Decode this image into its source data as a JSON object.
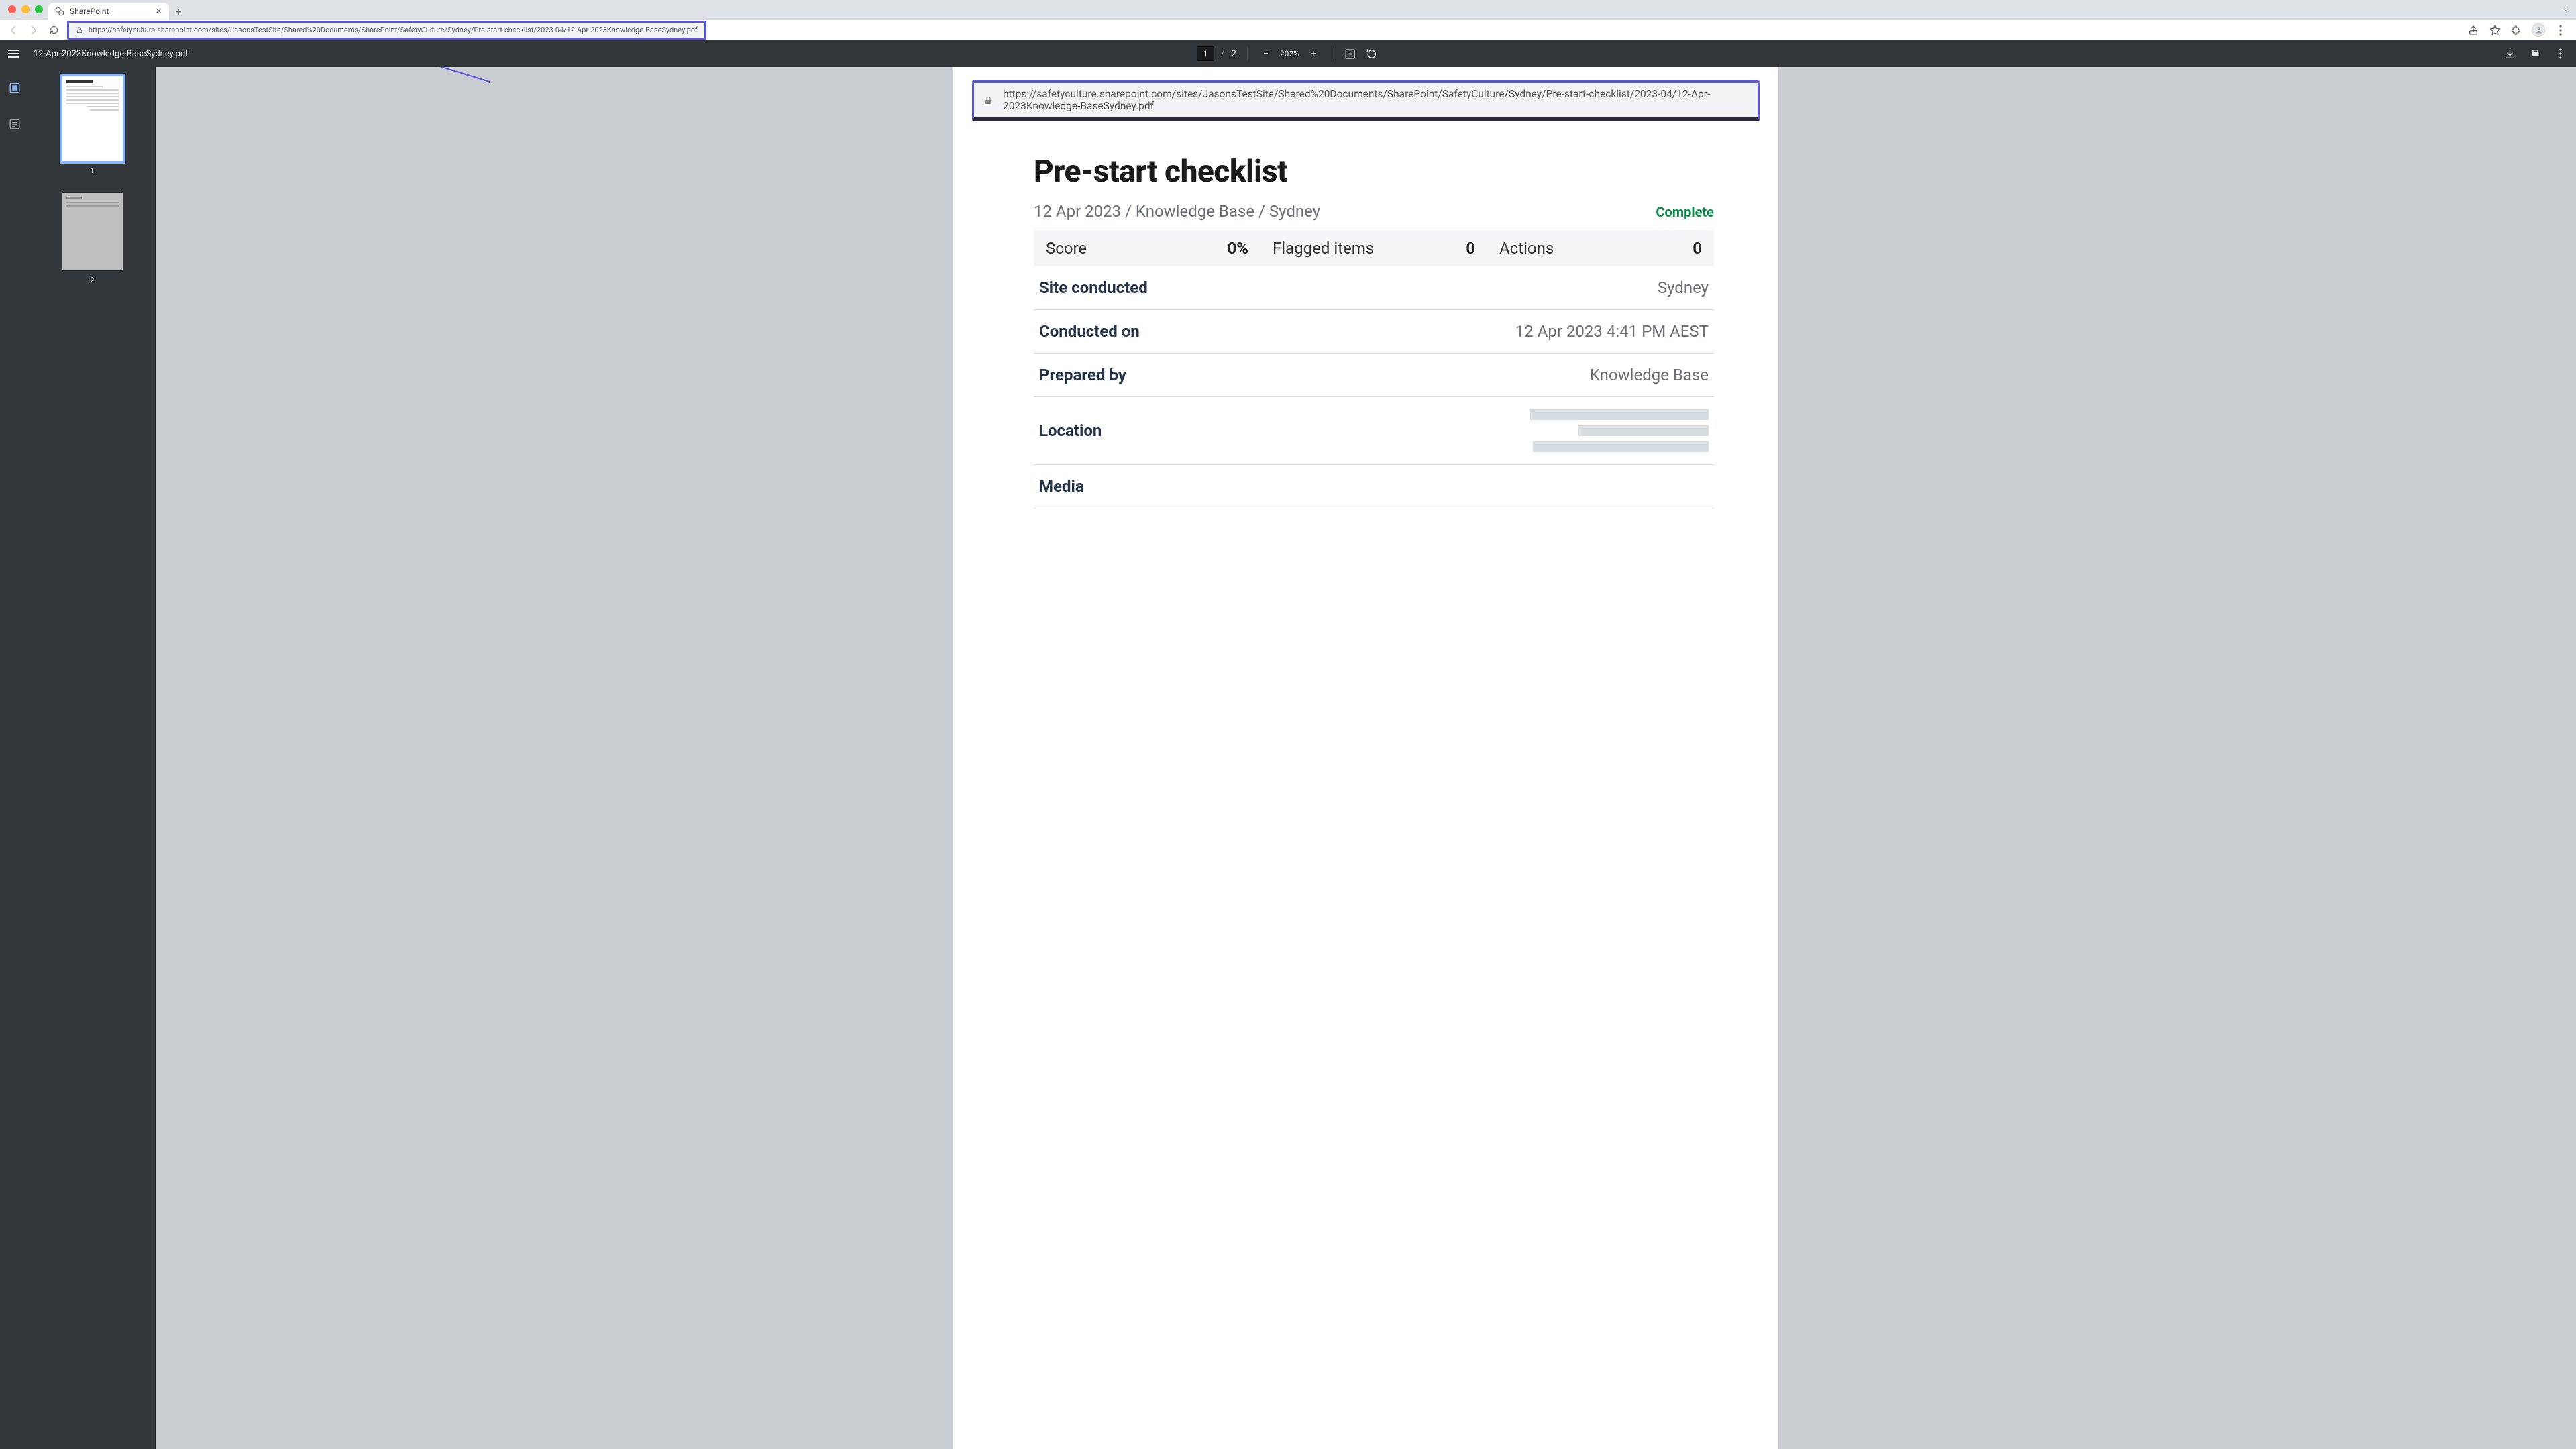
{
  "browser": {
    "tab_title": "SharePoint",
    "url": "https://safetyculture.sharepoint.com/sites/JasonsTestSite/Shared%20Documents/SharePoint/SafetyCulture/Sydney/Pre-start-checklist/2023-04/12-Apr-2023Knowledge-BaseSydney.pdf"
  },
  "pdf_viewer": {
    "file_name": "12-Apr-2023Knowledge-BaseSydney.pdf",
    "current_page": "1",
    "page_separator": "/",
    "total_pages": "2",
    "zoom": "202%",
    "thumb1_label": "1",
    "thumb2_label": "2"
  },
  "callout": {
    "url": "https://safetyculture.sharepoint.com/sites/JasonsTestSite/Shared%20Documents/SharePoint/SafetyCulture/Sydney/Pre-start-checklist/2023-04/12-Apr-2023Knowledge-BaseSydney.pdf"
  },
  "document": {
    "title": "Pre-start checklist",
    "subhead": "12 Apr 2023 / Knowledge Base / Sydney",
    "status": "Complete",
    "stats": {
      "score_label": "Score",
      "score_value": "0%",
      "flagged_label": "Flagged items",
      "flagged_value": "0",
      "actions_label": "Actions",
      "actions_value": "0"
    },
    "fields": {
      "site_conducted_label": "Site conducted",
      "site_conducted_value": "Sydney",
      "conducted_on_label": "Conducted on",
      "conducted_on_value": "12 Apr 2023 4:41 PM AEST",
      "prepared_by_label": "Prepared by",
      "prepared_by_value": "Knowledge Base",
      "location_label": "Location",
      "media_label": "Media"
    }
  }
}
